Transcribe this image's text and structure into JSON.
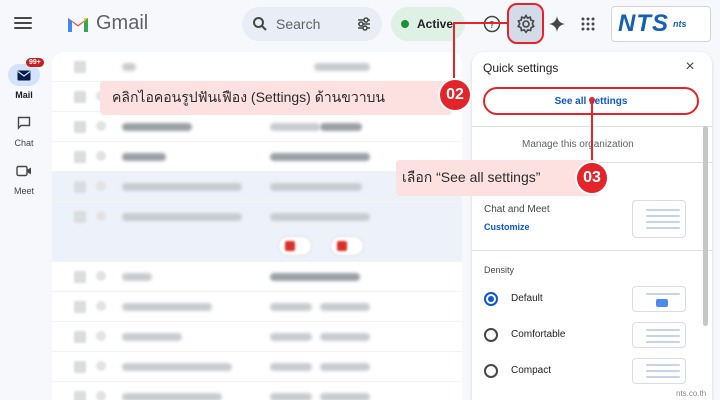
{
  "app": {
    "name": "Gmail"
  },
  "header": {
    "search_placeholder": "Search",
    "status": "Active",
    "brand_main": "NTS",
    "brand_small": "nts"
  },
  "rail": [
    {
      "label": "Mail",
      "badge": "99+"
    },
    {
      "label": "Chat"
    },
    {
      "label": "Meet"
    }
  ],
  "quick_settings": {
    "title": "Quick settings",
    "close": "×",
    "see_all": "See all settings",
    "manage": "Manage this organization",
    "chat_meet_label": "Chat and Meet",
    "customize": "Customize",
    "density_label": "Density",
    "density_options": [
      {
        "label": "Default",
        "selected": true
      },
      {
        "label": "Comfortable",
        "selected": false
      },
      {
        "label": "Compact",
        "selected": false
      }
    ]
  },
  "annotations": {
    "step1": {
      "number": "02",
      "text": "คลิกไอคอนรูปฟันเฟือง (Settings) ด้านขวาบน"
    },
    "step2": {
      "number": "03",
      "text": "เลือก “See all settings”"
    }
  },
  "watermark": "nts.co.th",
  "colors": {
    "accent_red": "#e3242b",
    "link_blue": "#0b57d0",
    "brand_blue": "#1360b5",
    "active_green": "#1e8e3e"
  }
}
